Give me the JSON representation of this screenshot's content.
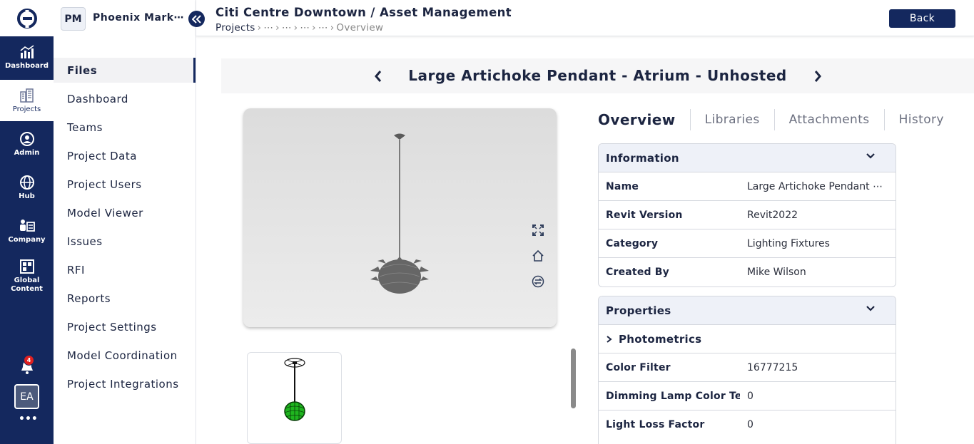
{
  "rail": {
    "items": [
      {
        "label": "Dashboard"
      },
      {
        "label": "Projects"
      },
      {
        "label": "Admin"
      },
      {
        "label": "Hub"
      },
      {
        "label": "Company"
      },
      {
        "label": "Global Content"
      }
    ],
    "notification_count": "4",
    "avatar_initials": "EA",
    "more": "•••"
  },
  "project": {
    "badge": "PM",
    "name": "Phoenix Mark⋯",
    "nav": [
      {
        "label": "Files"
      },
      {
        "label": "Dashboard"
      },
      {
        "label": "Teams"
      },
      {
        "label": "Project Data"
      },
      {
        "label": "Project Users"
      },
      {
        "label": "Model Viewer"
      },
      {
        "label": "Issues"
      },
      {
        "label": "RFI"
      },
      {
        "label": "Reports"
      },
      {
        "label": "Project Settings"
      },
      {
        "label": "Model Coordination"
      },
      {
        "label": "Project Integrations"
      }
    ]
  },
  "header": {
    "title": "Citi Centre Downtown / Asset Management",
    "breadcrumb": {
      "root": "Projects",
      "ellipsis": "⋯",
      "current": "Overview"
    },
    "back_label": "Back"
  },
  "asset": {
    "title": "Large Artichoke Pendant - Atrium - Unhosted"
  },
  "tabs": [
    {
      "label": "Overview"
    },
    {
      "label": "Libraries"
    },
    {
      "label": "Attachments"
    },
    {
      "label": "History"
    }
  ],
  "information": {
    "title": "Information",
    "rows": [
      {
        "key": "Name",
        "value": "Large Artichoke Pendant ⋯"
      },
      {
        "key": "Revit Version",
        "value": "Revit2022"
      },
      {
        "key": "Category",
        "value": "Lighting Fixtures"
      },
      {
        "key": "Created By",
        "value": "Mike Wilson"
      }
    ]
  },
  "properties": {
    "title": "Properties",
    "group": "Photometrics",
    "rows": [
      {
        "key": "Color Filter",
        "value": "16777215"
      },
      {
        "key": "Dimming Lamp Color Te⋯",
        "value": "0"
      },
      {
        "key": "Light Loss Factor",
        "value": "0"
      }
    ]
  },
  "colors": {
    "navy": "#14285e",
    "panel_header": "#eef1f8",
    "thumb_green": "#2ecc2e"
  }
}
